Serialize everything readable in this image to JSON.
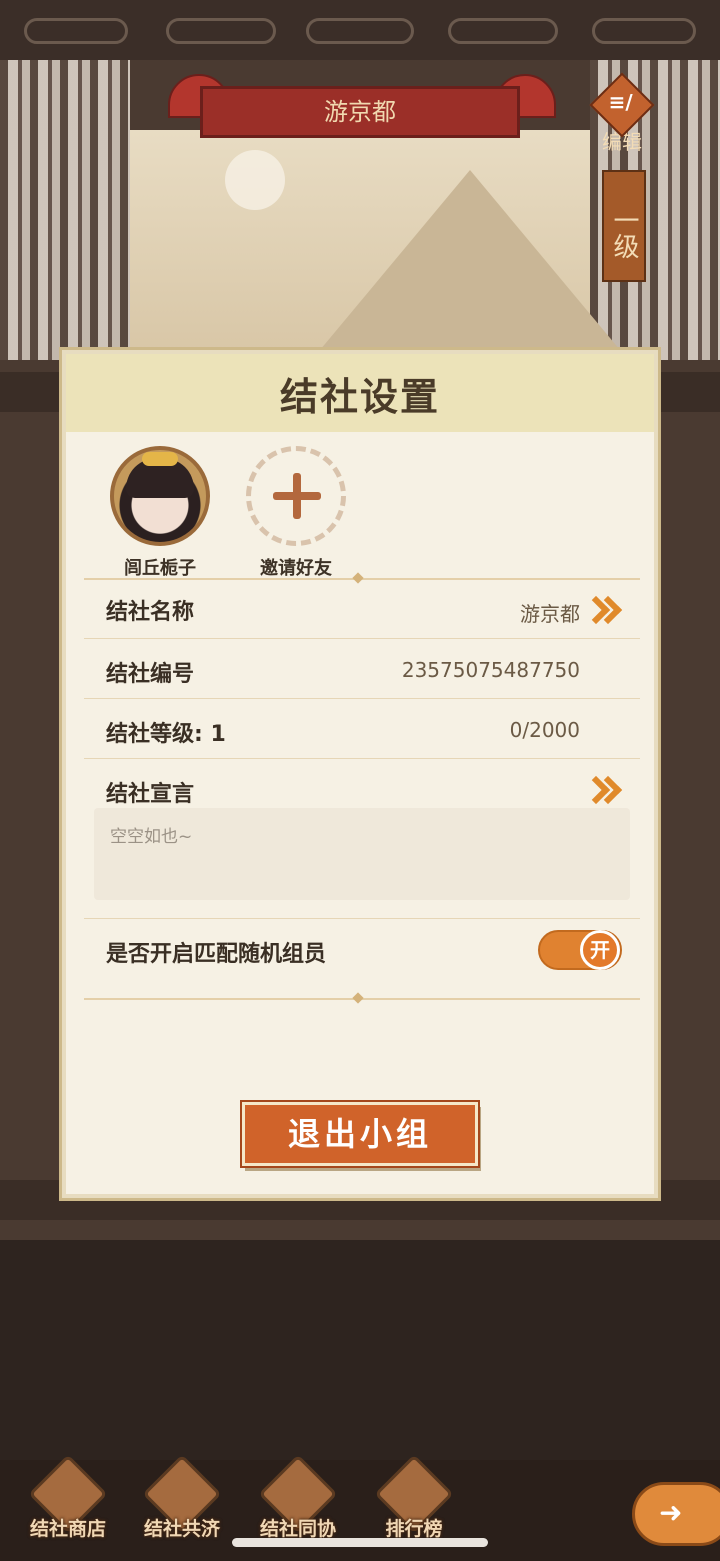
{
  "banner": {
    "title": "游京都"
  },
  "header_actions": {
    "edit_label": "编辑",
    "level_label": "一级"
  },
  "dialog": {
    "title": "结社设置",
    "members": [
      {
        "name": "闾丘栀子"
      },
      {
        "name": "邀请好友"
      }
    ],
    "rows": {
      "name_label": "结社名称",
      "name_value": "游京都",
      "id_label": "结社编号",
      "id_value": "23575075487750",
      "level_label": "结社等级: 1",
      "level_value": "0/2000",
      "manifesto_label": "结社宣言",
      "manifesto_text": "空空如也~",
      "random_match_label": "是否开启匹配随机组员",
      "random_match_toggle": "开"
    },
    "exit_button": "退出小组"
  },
  "bottom_tabs": [
    {
      "label": "结社商店"
    },
    {
      "label": "结社共济"
    },
    {
      "label": "结社同协"
    },
    {
      "label": "排行榜"
    }
  ],
  "colors": {
    "accent": "#e08230",
    "button": "#d0632a",
    "banner": "#9b2f28"
  },
  "icons": [
    "edit-icon",
    "plus-icon",
    "chevron-right-icon",
    "shop-icon",
    "aid-icon",
    "cooperate-icon",
    "ranking-icon",
    "back-icon"
  ]
}
